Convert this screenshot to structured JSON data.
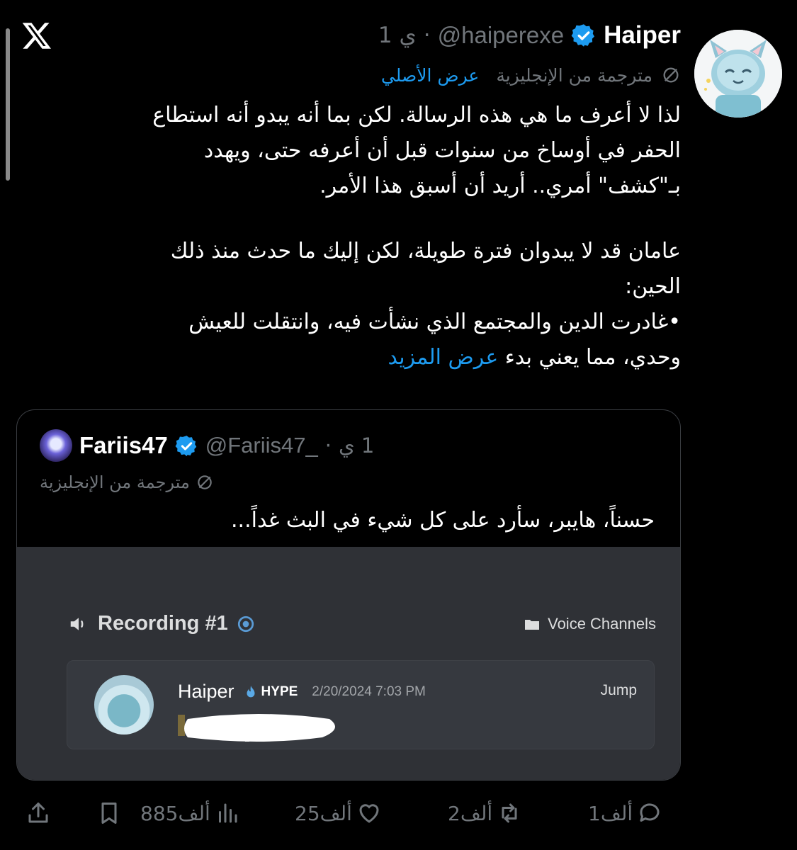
{
  "window": {
    "close_icon": "x-logo-icon"
  },
  "tweet": {
    "author_name": "Haiper",
    "handle": "@haiperexe",
    "separator": "·",
    "age": "1 ي",
    "translated_label": "مترجمة من الإنجليزية",
    "show_original": "عرض الأصلي",
    "lines": [
      "لذا لا أعرف ما هي هذه الرسالة. لكن بما أنه يبدو أنه استطاع",
      "الحفر في أوساخ من سنوات قبل أن أعرفه حتى، ويهدد",
      "بـ\"كشف\" أمري.. أريد أن أسبق هذا الأمر.",
      "عامان قد لا يبدوان فترة طويلة، لكن إليك ما حدث منذ ذلك",
      "الحين:",
      "•غادرت الدين والمجتمع الذي نشأت فيه، وانتقلت للعيش"
    ],
    "last_line": "وحدي، مما يعني بدء",
    "show_more": "عرض المزيد"
  },
  "quote": {
    "author_name": "Fariis47",
    "handle": "@Fariis47_",
    "age": "1 ي",
    "separator": "·",
    "translated_label": "مترجمة من الإنجليزية",
    "text": "حسناً، هايبر، سأرد على كل شيء في البث غداً...",
    "discord": {
      "title": "Recording #1",
      "channel": "Voice Channels",
      "message": {
        "author": "Haiper",
        "badge": "HYPE",
        "timestamp": "2/20/2024 7:03 PM",
        "jump_label": "Jump"
      }
    }
  },
  "actions": {
    "reply_count": "1ألف",
    "retweet_count": "2ألف",
    "like_count": "25ألف",
    "views_count": "885ألف"
  },
  "colors": {
    "background": "#000000",
    "link": "#1d9bf0",
    "muted": "#71767b",
    "verified": "#1d9bf0",
    "discord_bg": "#2f3136"
  }
}
